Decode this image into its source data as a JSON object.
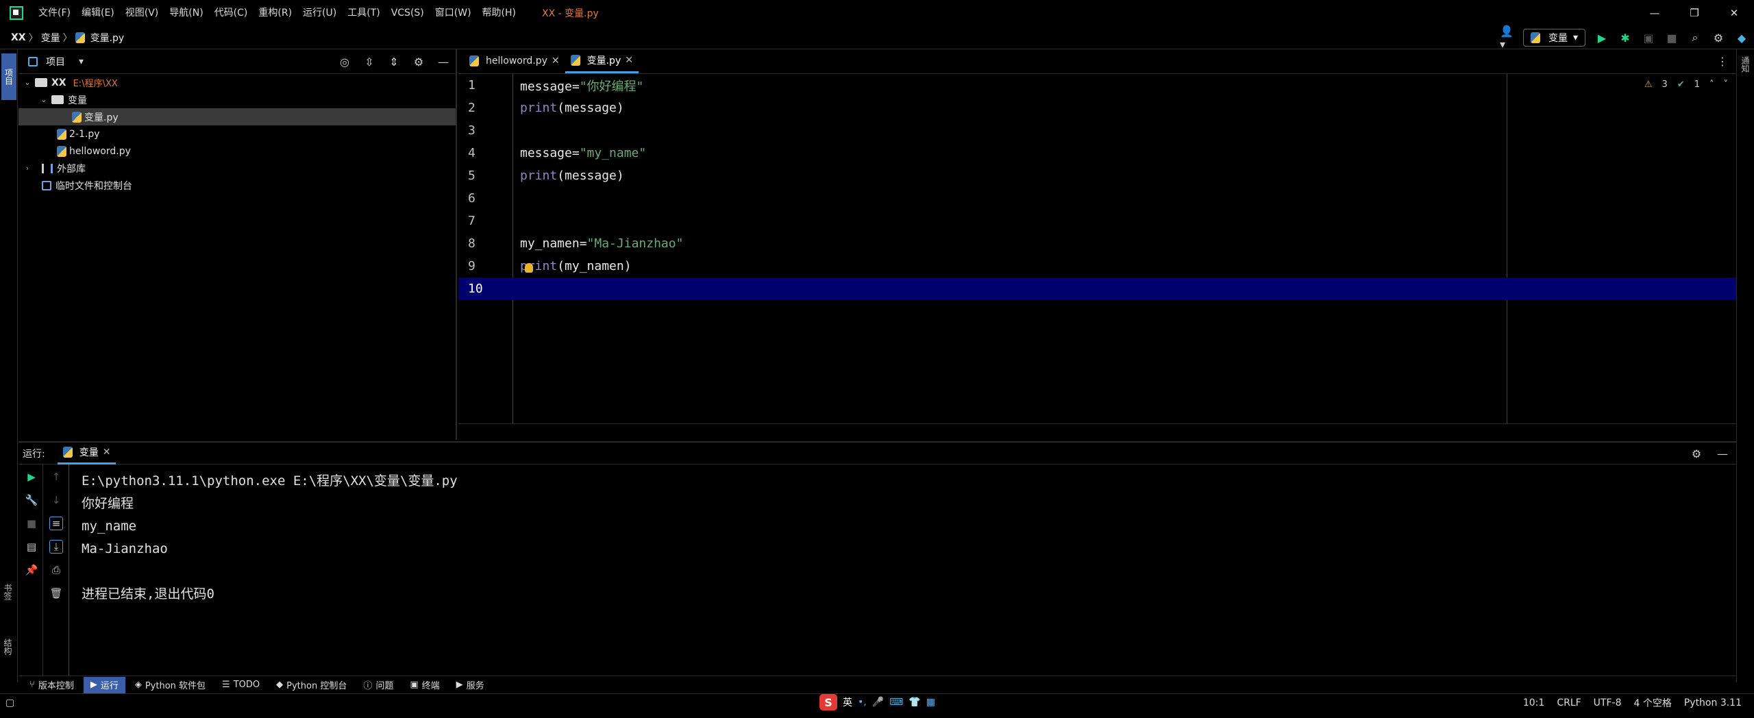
{
  "window": {
    "menu": [
      "文件(F)",
      "编辑(E)",
      "视图(V)",
      "导航(N)",
      "代码(C)",
      "重构(R)",
      "运行(U)",
      "工具(T)",
      "VCS(S)",
      "窗口(W)",
      "帮助(H)"
    ],
    "title": "XX - 变量.py",
    "controls": [
      "—",
      "❐",
      "✕"
    ]
  },
  "navbar": {
    "breadcrumb": [
      "XX",
      "变量",
      "变量.py"
    ],
    "run_config": "变量"
  },
  "left_stripe": {
    "project": "项目",
    "bookmarks": "书签",
    "structure": "结构"
  },
  "right_stripe": {
    "notifications": "通知"
  },
  "project_panel": {
    "title": "项目",
    "tree": {
      "root": "XX",
      "root_path": "E:\\程序\\XX",
      "folder": "变量",
      "selected_file": "变量.py",
      "file2": "2-1.py",
      "file3": "helloword.py",
      "external": "外部库",
      "scratches": "临时文件和控制台"
    }
  },
  "editor": {
    "tabs": [
      {
        "label": "helloword.py"
      },
      {
        "label": "变量.py"
      }
    ],
    "inspections": {
      "warnings": "3",
      "ok": "1"
    },
    "lines": [
      {
        "n": "1",
        "a": "message=",
        "s": "\"你好编程\"",
        "b": ""
      },
      {
        "n": "2",
        "f": "print",
        "b": "(message)"
      },
      {
        "n": "3"
      },
      {
        "n": "4",
        "a": "message=",
        "s": "\"my_name\"",
        "b": ""
      },
      {
        "n": "5",
        "f": "print",
        "b": "(message)"
      },
      {
        "n": "6"
      },
      {
        "n": "7"
      },
      {
        "n": "8",
        "a": "my_namen=",
        "s": "\"Ma-Jianzhao\"",
        "b": ""
      },
      {
        "n": "9",
        "f": "print",
        "b": "(my_namen)"
      },
      {
        "n": "10"
      }
    ]
  },
  "run_panel": {
    "label": "运行:",
    "tab": "变量",
    "console": [
      "E:\\python3.11.1\\python.exe E:\\程序\\XX\\变量\\变量.py",
      "你好编程",
      "my_name",
      "Ma-Jianzhao",
      "",
      "进程已结束,退出代码0"
    ]
  },
  "bottom_tools": [
    "版本控制",
    "运行",
    "Python 软件包",
    "TODO",
    "Python 控制台",
    "问题",
    "终端",
    "服务"
  ],
  "statusbar": {
    "position": "10:1",
    "line_sep": "CRLF",
    "encoding": "UTF-8",
    "indent": "4 个空格",
    "interpreter": "Python 3.11"
  },
  "ime": {
    "logo": "S",
    "mode": "英"
  },
  "colors": {
    "accent": "#3a5ea8",
    "current_line": "#00006e",
    "string": "#6aab73",
    "builtin": "#8888c6",
    "title_hint": "#e0783c",
    "run_green": "#21d789"
  }
}
